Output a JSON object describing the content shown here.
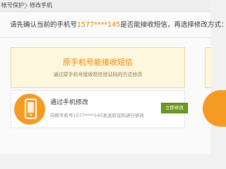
{
  "breadcrumb": {
    "item1": "帐号保护",
    "item2": "修改手机"
  },
  "prompt": {
    "before": "请先确认当前的手机号",
    "phone": "1577****145",
    "after": "是否能接收短信，再选择修改方式："
  },
  "option_card": {
    "title": "原手机号能接收短信",
    "subtitle": "通过原手机号接收短信验证码的方式修改"
  },
  "method_row": {
    "title": "通过手机修改",
    "description": "向原手机号1577****145发送验证码进行修改",
    "button_label": "立即修改"
  },
  "colors": {
    "accent_orange": "#f08300",
    "icon_orange": "#f59a23",
    "button_green": "#6a9a1f"
  }
}
